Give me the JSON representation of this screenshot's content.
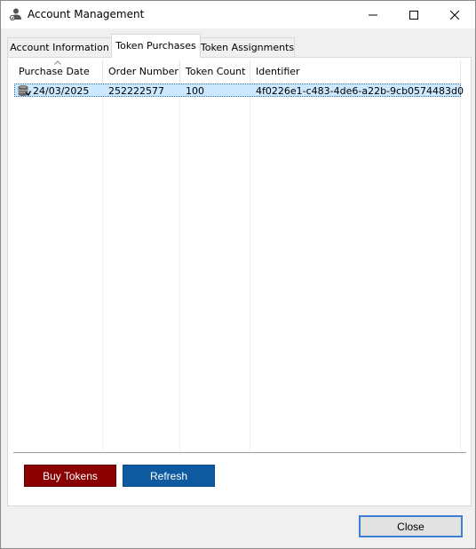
{
  "window": {
    "title": "Account Management"
  },
  "tabs": [
    {
      "label": "Account Information"
    },
    {
      "label": "Token Purchases"
    },
    {
      "label": "Token Assignments"
    }
  ],
  "active_tab": "Token Purchases",
  "table": {
    "columns": [
      "Purchase Date",
      "Order Number",
      "Token Count",
      "Identifier"
    ],
    "sorted_column": "Purchase Date",
    "rows": [
      {
        "purchase_date": "24/03/2025",
        "order_number": "252222577",
        "token_count": "100",
        "identifier": "4f0226e1-c483-4de6-a22b-9cb0574483d0",
        "selected": true
      }
    ]
  },
  "buttons": {
    "buy_tokens": "Buy Tokens",
    "refresh": "Refresh",
    "close": "Close"
  },
  "colors": {
    "buy_button": "#8b0000",
    "refresh_button": "#0d5aa0",
    "selected_row": "#cce8ff"
  }
}
